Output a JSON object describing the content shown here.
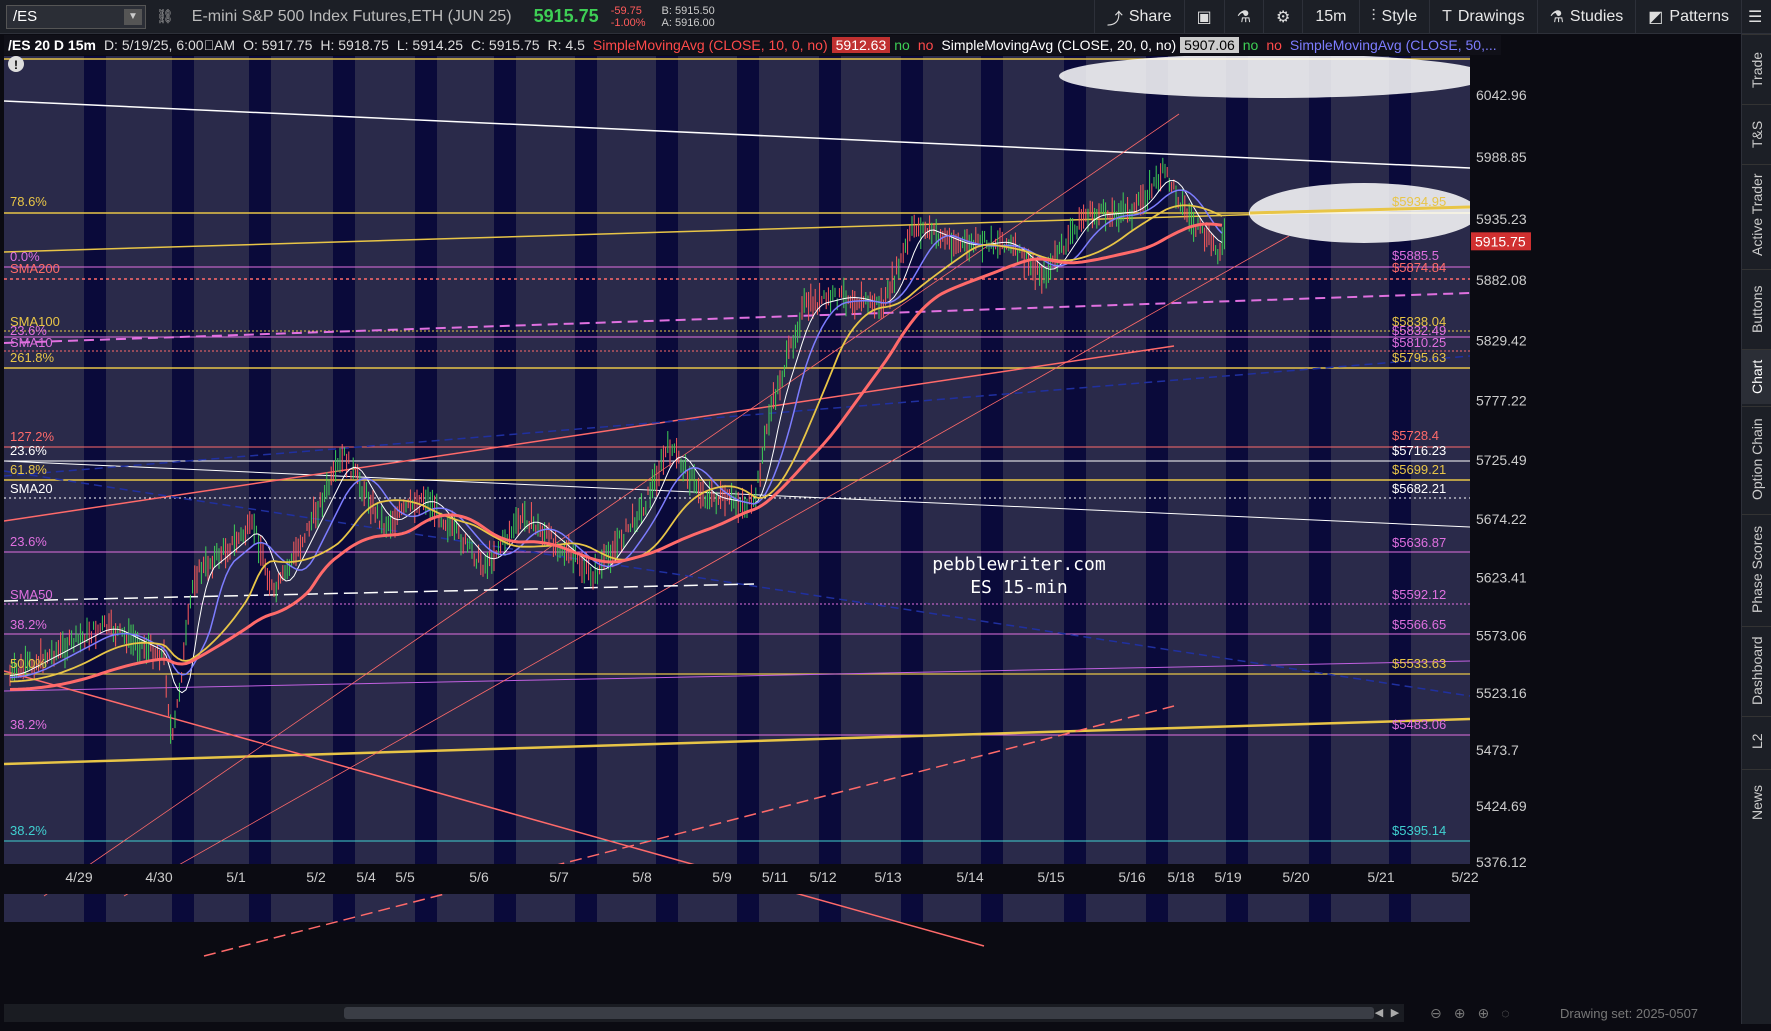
{
  "toolbar": {
    "symbol": "/ES",
    "instrument": "E-mini S&P 500 Index Futures,ETH (JUN 25)",
    "last_price": "5915.75",
    "change": "-59.75",
    "change_pct": "-1.00%",
    "bid": "B: 5915.50",
    "ask": "A: 5916.00",
    "buttons": {
      "share": "Share",
      "timeframe": "15m",
      "style": "Style",
      "drawings": "Drawings",
      "studies": "Studies",
      "patterns": "Patterns"
    }
  },
  "infobar": {
    "symbol": "/ES 20 D 15m",
    "date": "D: 5/19/25, 6:00\u0000AM",
    "open": "O: 5917.75",
    "high": "H: 5918.75",
    "low": "L: 5914.25",
    "close": "C: 5915.75",
    "range": "R: 4.5",
    "sma10_label": "SimpleMovingAvg (CLOSE, 10, 0, no)",
    "sma10_value": "5912.63",
    "no1": "no",
    "no2": "no",
    "sma20_label": "SimpleMovingAvg (CLOSE, 20, 0, no)",
    "sma20_value": "5907.06",
    "no3": "no",
    "no4": "no",
    "sma50_label": "SimpleMovingAvg (CLOSE, 50,..."
  },
  "price_axis": {
    "labels": [
      "6042.96",
      "5988.85",
      "5935.23",
      "5882.08",
      "5829.42",
      "5777.22",
      "5725.49",
      "5674.22",
      "5623.41",
      "5573.06",
      "5523.16",
      "5473.7",
      "5424.69",
      "5376.12"
    ],
    "current_price": "5915.75"
  },
  "time_axis": {
    "labels": [
      "4/29",
      "4/30",
      "5/1",
      "5/2",
      "5/4",
      "5/5",
      "5/6",
      "5/7",
      "5/8",
      "5/9",
      "5/11",
      "5/12",
      "5/13",
      "5/14",
      "5/15",
      "5/16",
      "5/18",
      "5/19",
      "5/20",
      "5/21",
      "5/22"
    ]
  },
  "left_annotations": [
    {
      "text": "78.6%",
      "color": "#e8c547"
    },
    {
      "text": "0.0%",
      "color": "#e070e0"
    },
    {
      "text": "SMA200",
      "color": "#ff6a6a"
    },
    {
      "text": "SMA100",
      "color": "#e8c547"
    },
    {
      "text": "23.6%",
      "color": "#e070e0"
    },
    {
      "text": "SMA10",
      "color": "#e070e0"
    },
    {
      "text": "261.8%",
      "color": "#e8c547"
    },
    {
      "text": "127.2%",
      "color": "#ff6a6a"
    },
    {
      "text": "23.6%",
      "color": "#ffffff"
    },
    {
      "text": "61.8%",
      "color": "#e8c547"
    },
    {
      "text": "SMA20",
      "color": "#ffffff"
    },
    {
      "text": "23.6%",
      "color": "#e070e0"
    },
    {
      "text": "SMA50",
      "color": "#e070e0"
    },
    {
      "text": "38.2%",
      "color": "#e070e0"
    },
    {
      "text": "50.0%",
      "color": "#e8c547"
    },
    {
      "text": "38.2%",
      "color": "#e070e0"
    },
    {
      "text": "38.2%",
      "color": "#40d0d0"
    }
  ],
  "right_annotations": [
    {
      "text": "$5934.95",
      "color": "#e8c547"
    },
    {
      "text": "$5885.5",
      "color": "#e070e0"
    },
    {
      "text": "$5874.84",
      "color": "#ff6a6a"
    },
    {
      "text": "$5838.04",
      "color": "#e8c547"
    },
    {
      "text": "$5832.49",
      "color": "#e070e0"
    },
    {
      "text": "$5810.25",
      "color": "#e070e0"
    },
    {
      "text": "$5795.63",
      "color": "#e8c547"
    },
    {
      "text": "$5728.4",
      "color": "#ff6a6a"
    },
    {
      "text": "$5716.23",
      "color": "#ffffff"
    },
    {
      "text": "$5699.21",
      "color": "#e8c547"
    },
    {
      "text": "$5682.21",
      "color": "#ffffff"
    },
    {
      "text": "$5636.87",
      "color": "#e070e0"
    },
    {
      "text": "$5592.12",
      "color": "#e070e0"
    },
    {
      "text": "$5566.65",
      "color": "#e070e0"
    },
    {
      "text": "$5533.63",
      "color": "#e8c547"
    },
    {
      "text": "$5483.06",
      "color": "#e070e0"
    },
    {
      "text": "$5395.14",
      "color": "#40d0d0"
    }
  ],
  "watermark": {
    "line1": "pebblewriter.com",
    "line2": "ES 15-min"
  },
  "sidebar": {
    "tabs": [
      "Trade",
      "T&S",
      "Active Trader",
      "Buttons",
      "Chart",
      "Option Chain",
      "Phase Scores",
      "Dashboard",
      "L2",
      "News"
    ]
  },
  "status": {
    "drawing_set": "Drawing set: 2025-0507"
  },
  "colors": {
    "price_up": "#3ecf55",
    "price_down": "#ff5b5b",
    "fib_gold": "#e8c547",
    "fib_magenta": "#e070e0",
    "sma_red": "#ff6a6a",
    "band_dark": "#0a0a3a",
    "band_light": "#2a2a4a"
  }
}
